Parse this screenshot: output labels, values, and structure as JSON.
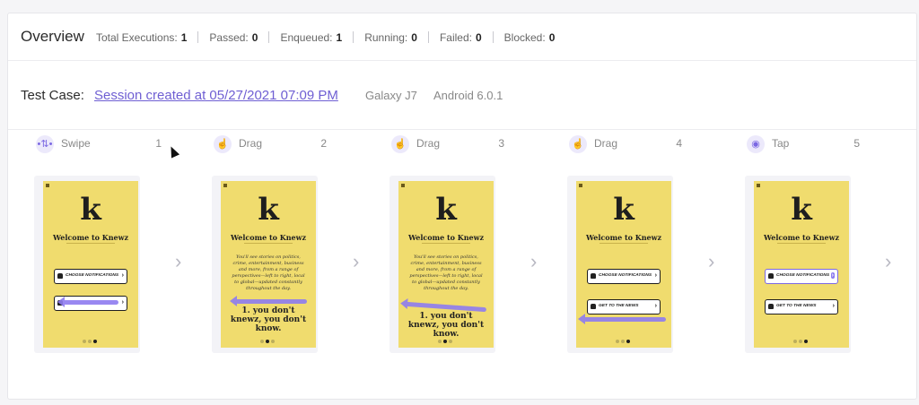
{
  "overview": {
    "title": "Overview",
    "stats": [
      {
        "label": "Total Executions:",
        "value": "1"
      },
      {
        "label": "Passed:",
        "value": "0"
      },
      {
        "label": "Enqueued:",
        "value": "1"
      },
      {
        "label": "Running:",
        "value": "0"
      },
      {
        "label": "Failed:",
        "value": "0"
      },
      {
        "label": "Blocked:",
        "value": "0"
      }
    ]
  },
  "test_case": {
    "label": "Test Case:",
    "session_link": "Session created at 05/27/2021 07:09 PM",
    "device": "Galaxy J7",
    "os": "Android 6.0.1"
  },
  "colors": {
    "accent": "#6f5fd3",
    "phone_bg": "#f0dc6e",
    "gesture": "#8e7cf0"
  },
  "steps": [
    {
      "icon": "swipe-icon",
      "label": "Swipe",
      "num": "1"
    },
    {
      "icon": "drag-icon",
      "label": "Drag",
      "num": "2"
    },
    {
      "icon": "drag-icon",
      "label": "Drag",
      "num": "3"
    },
    {
      "icon": "drag-icon",
      "label": "Drag",
      "num": "4"
    },
    {
      "icon": "tap-icon",
      "label": "Tap",
      "num": "5"
    }
  ],
  "screen": {
    "logo": "k",
    "welcome": "Welcome to Knewz",
    "body": "You'll see stories on politics, crime, entertainment, business and more, from a range of perspectives—left to right, local to global—updated constantly throughout the day.",
    "big": "1. you don't knewz, you don't know.",
    "btn_notifications": "CHOOSE NOTIFICATIONS",
    "btn_news": "GET TO THE NEWS"
  }
}
